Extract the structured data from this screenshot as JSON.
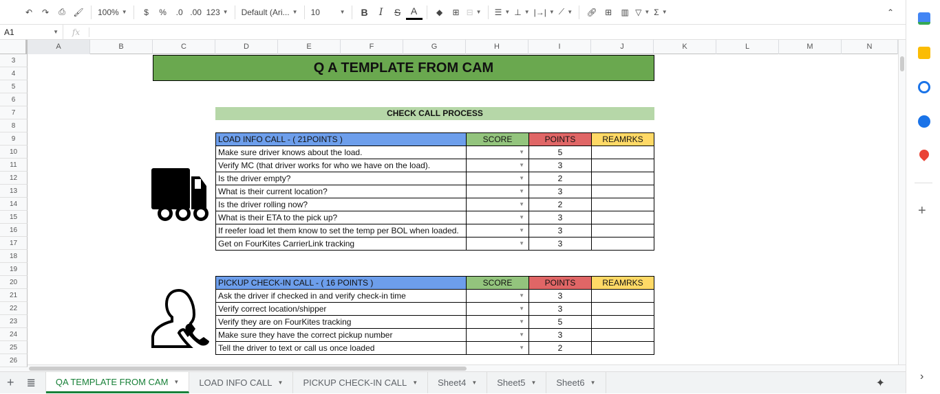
{
  "toolbar": {
    "zoom": "100%",
    "currency": "$",
    "percent": "%",
    "dec_less": ".0",
    "dec_more": ".00",
    "format": "123",
    "font": "Default (Ari...",
    "font_size": "10",
    "bold": "B",
    "italic": "I",
    "strike": "S",
    "text_color": "A",
    "sigma": "Σ"
  },
  "formula_bar": {
    "cell_ref": "A1",
    "fx": "fx",
    "value": ""
  },
  "columns": [
    "A",
    "B",
    "C",
    "D",
    "E",
    "F",
    "G",
    "H",
    "I",
    "J",
    "K",
    "L",
    "M",
    "N"
  ],
  "rows": [
    "3",
    "4",
    "5",
    "6",
    "7",
    "8",
    "9",
    "10",
    "11",
    "12",
    "13",
    "14",
    "15",
    "16",
    "17",
    "18",
    "19",
    "20",
    "21",
    "22",
    "23",
    "24",
    "25",
    "26"
  ],
  "sheet": {
    "title": "Q A TEMPLATE FROM CAM",
    "subtitle": "CHECK CALL PROCESS",
    "tables": [
      {
        "header": "LOAD INFO CALL  - ( 21POINTS )",
        "score": "SCORE",
        "points": "POINTS",
        "remarks": "REAMRKS",
        "items": [
          {
            "task": "Make sure driver knows about the load.",
            "points": "5"
          },
          {
            "task": "Verify MC (that driver works for who we have on the load).",
            "points": "3"
          },
          {
            "task": "Is the driver empty?",
            "points": "2"
          },
          {
            "task": "What is their current location?",
            "points": "3"
          },
          {
            "task": "Is the driver rolling now?",
            "points": "2"
          },
          {
            "task": "What is their ETA to the pick up?",
            "points": "3"
          },
          {
            "task": "If reefer load let them know to set the temp per BOL when loaded.",
            "points": "3"
          },
          {
            "task": "Get on FourKites CarrierLink tracking",
            "points": "3"
          }
        ]
      },
      {
        "header": "PICKUP CHECK-IN CALL -  ( 16 POINTS )",
        "score": "SCORE",
        "points": "POINTS",
        "remarks": "REAMRKS",
        "items": [
          {
            "task": "Ask the driver if checked in and verify check-in time",
            "points": "3"
          },
          {
            "task": "Verify correct location/shipper",
            "points": "3"
          },
          {
            "task": "Verify they are on FourKites tracking",
            "points": "5"
          },
          {
            "task": "Make sure they have the correct pickup number",
            "points": "3"
          },
          {
            "task": "Tell the driver to text or call us once loaded",
            "points": "2"
          }
        ]
      }
    ]
  },
  "tabs": [
    {
      "label": "QA TEMPLATE FROM CAM",
      "active": true
    },
    {
      "label": "LOAD INFO CALL"
    },
    {
      "label": "PICKUP CHECK-IN CALL"
    },
    {
      "label": "Sheet4"
    },
    {
      "label": "Sheet5"
    },
    {
      "label": "Sheet6"
    }
  ],
  "colors": {
    "title_bg": "#6aa84f",
    "subtitle_bg": "#b6d7a8",
    "header_bg": "#6d9eeb",
    "score_bg": "#93c47d",
    "points_bg": "#e06666",
    "remarks_bg": "#ffd966"
  }
}
